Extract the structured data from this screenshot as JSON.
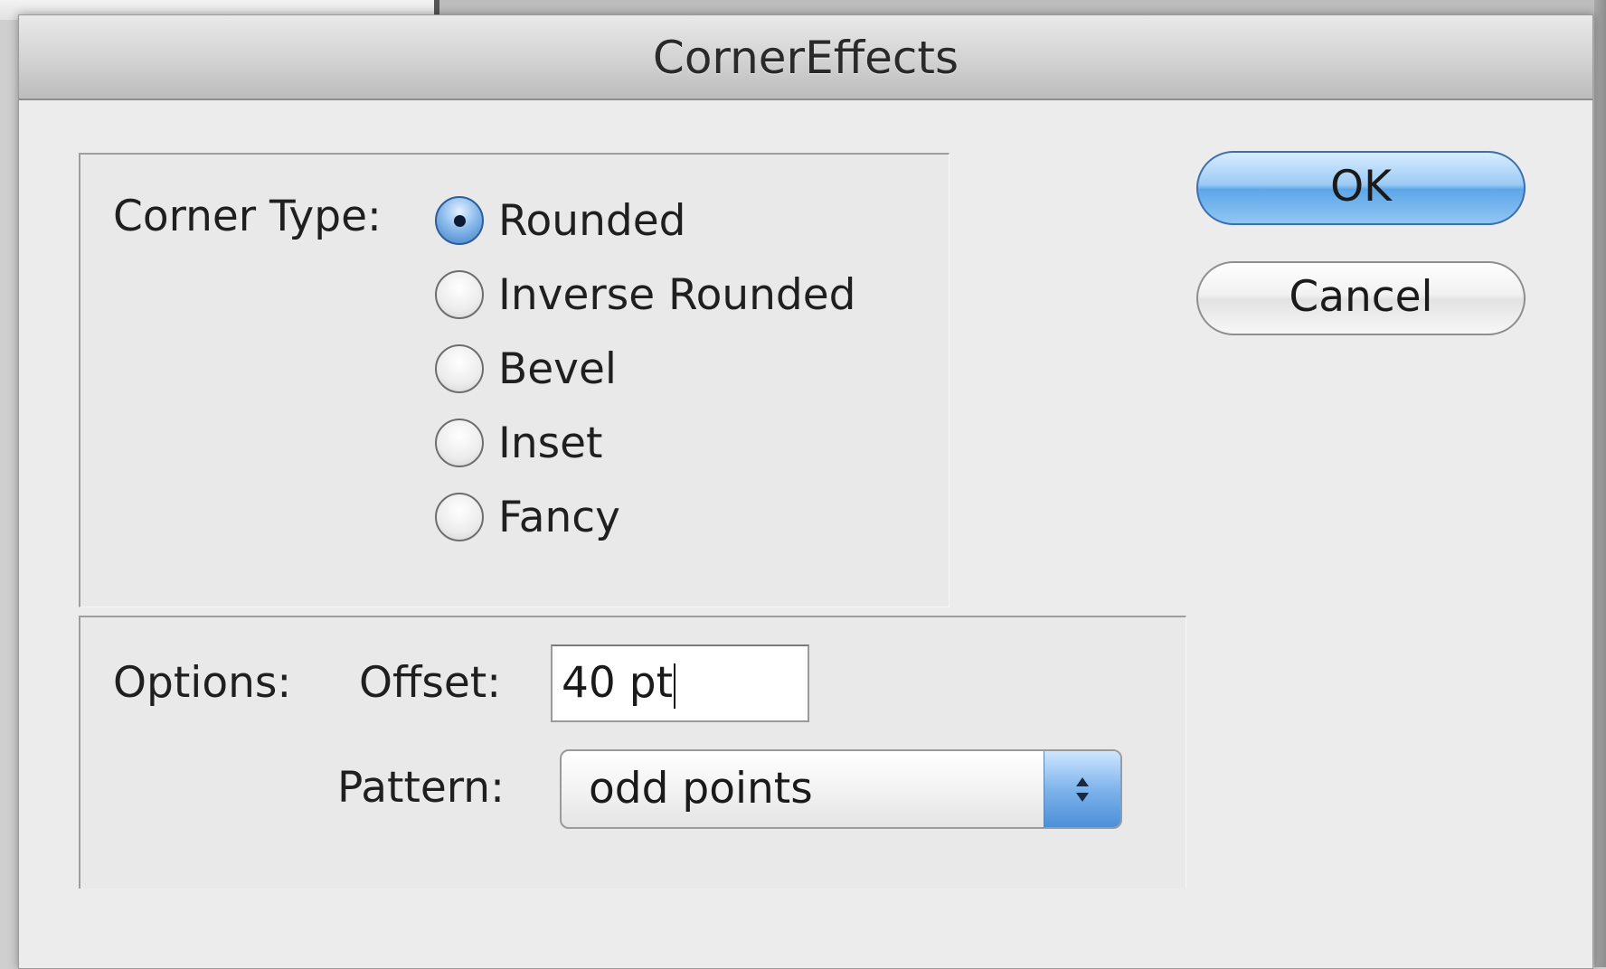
{
  "dialog": {
    "title": "CornerEffects"
  },
  "corner_type": {
    "label": "Corner Type:",
    "options": [
      {
        "label": "Rounded",
        "selected": true
      },
      {
        "label": "Inverse Rounded",
        "selected": false
      },
      {
        "label": "Bevel",
        "selected": false
      },
      {
        "label": "Inset",
        "selected": false
      },
      {
        "label": "Fancy",
        "selected": false
      }
    ]
  },
  "options": {
    "label": "Options:",
    "offset_label": "Offset:",
    "offset_value": "40 pt",
    "pattern_label": "Pattern:",
    "pattern_value": "odd points"
  },
  "buttons": {
    "ok": "OK",
    "cancel": "Cancel"
  },
  "colors": {
    "default_button": "#9ccbf5",
    "dialog_bg": "#ececec"
  },
  "icons": {
    "select_arrows": "up-down-arrows-icon"
  }
}
